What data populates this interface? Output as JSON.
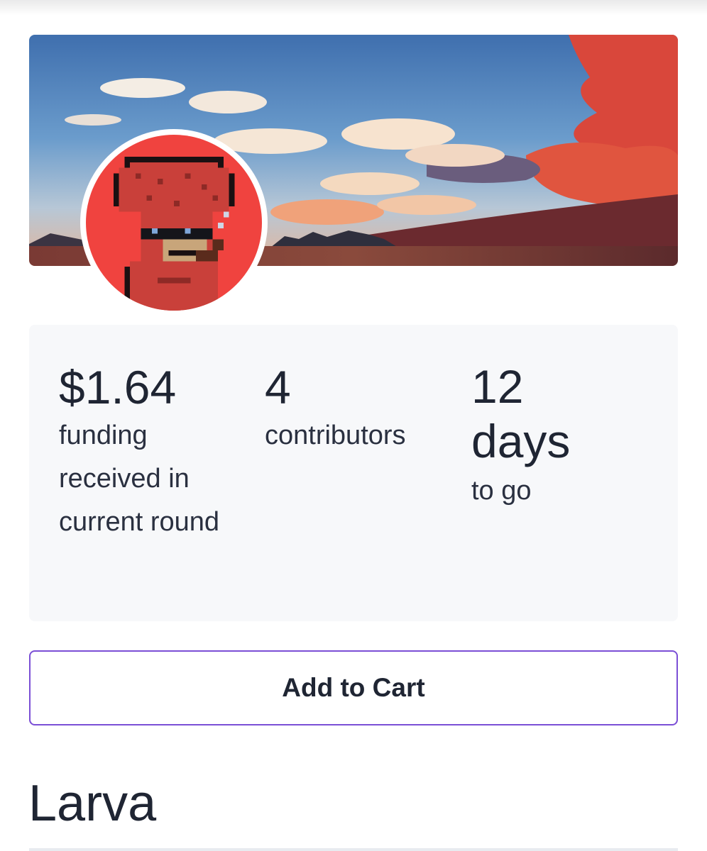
{
  "project": {
    "title": "Larva",
    "banner_image": "sunset-sky-landscape",
    "avatar_image": "pixel-art-ape-red-hat-sunglasses"
  },
  "stats": {
    "funding": {
      "value": "$1.64",
      "label": "funding received in current round"
    },
    "contributors": {
      "value": "4",
      "label": "contributors"
    },
    "time_left": {
      "value": "12",
      "unit": "days",
      "label": "to go"
    }
  },
  "actions": {
    "add_to_cart": "Add to Cart"
  },
  "colors": {
    "accent_border": "#7b4fd6",
    "text": "#1f2533",
    "stats_background": "#f7f8fa",
    "avatar_background": "#f0433f"
  }
}
